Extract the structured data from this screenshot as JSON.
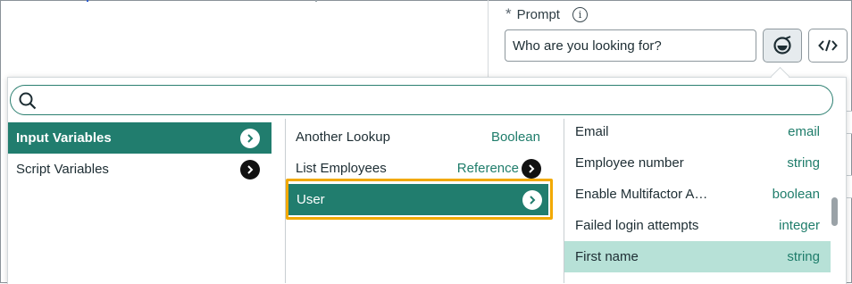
{
  "prompt": {
    "required_mark": "*",
    "label": "Prompt",
    "info_glyph": "i",
    "value": "Who are you looking for?"
  },
  "buttons": {
    "data_pill_icon": "data-pill-picker-icon",
    "script_icon": "code-icon"
  },
  "search": {
    "value": "",
    "placeholder": ""
  },
  "columns": {
    "col1": {
      "items": [
        {
          "label": "Input Variables",
          "selected": true
        },
        {
          "label": "Script Variables",
          "selected": false
        }
      ]
    },
    "col2": {
      "items": [
        {
          "label": "Another Lookup",
          "type": "Boolean"
        },
        {
          "label": "List Employees",
          "type": "Reference"
        },
        {
          "label": "User",
          "type": "",
          "selected": true
        }
      ]
    },
    "col3": {
      "items": [
        {
          "label": "Email",
          "type": "email"
        },
        {
          "label": "Employee number",
          "type": "string"
        },
        {
          "label": "Enable Multifactor A…",
          "type": "boolean"
        },
        {
          "label": "Failed login attempts",
          "type": "integer"
        },
        {
          "label": "First name",
          "type": "string",
          "highlighted": true
        }
      ]
    }
  },
  "colors": {
    "selected_row": "#217d6e",
    "highlight_row": "#b7e1d7",
    "type_text": "#1f7d6b",
    "focus_ring": "#f2a900",
    "search_border": "#2b7f70"
  }
}
